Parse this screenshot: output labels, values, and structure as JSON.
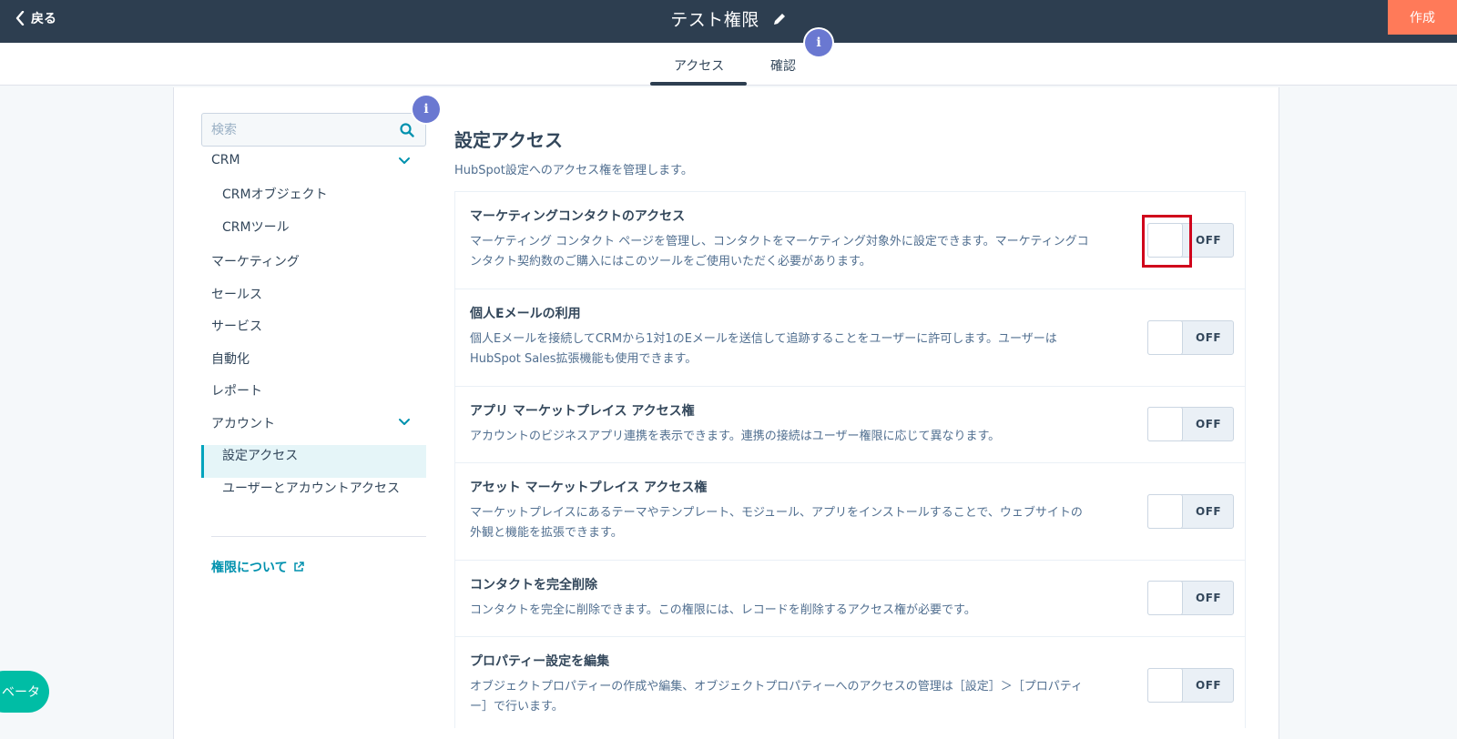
{
  "header": {
    "back_label": "戻る",
    "title": "テスト権限",
    "create_label": "作成",
    "colors": {
      "bar": "#2d3e50",
      "create": "#ff7a59"
    }
  },
  "tabs": [
    {
      "label": "アクセス",
      "active": true
    },
    {
      "label": "確認",
      "active": false
    }
  ],
  "info_badge": {
    "symbol": "i",
    "color": "#6a78d1"
  },
  "sidebar": {
    "search_placeholder": "検索",
    "items": [
      {
        "label": "CRM",
        "expandable": true
      },
      {
        "label": "CRMオブジェクト",
        "sub": true
      },
      {
        "label": "CRMツール",
        "sub": true
      },
      {
        "label": "マーケティング"
      },
      {
        "label": "セールス"
      },
      {
        "label": "サービス"
      },
      {
        "label": "自動化"
      },
      {
        "label": "レポート"
      },
      {
        "label": "アカウント",
        "expandable": true
      },
      {
        "label": "設定アクセス",
        "sub": true,
        "active": true
      },
      {
        "label": "ユーザーとアカウントアクセス",
        "sub": true
      }
    ],
    "about_link": "権限について"
  },
  "main": {
    "title": "設定アクセス",
    "description": "HubSpot設定へのアクセス権を管理します。",
    "permissions": [
      {
        "title": "マーケティングコンタクトのアクセス",
        "desc_line1": "マーケティング コンタクト ページを管理し、コンタクトをマーケティング対象外に設定できます。マーケティングコ",
        "desc_line2": "ンタクト契約数のご購入にはこのツールをご使用いただく必要があります。",
        "toggle": "OFF",
        "highlighted": true
      },
      {
        "title": "個人Eメールの利用",
        "desc_line1": "個人Eメールを接続してCRMから1対1のEメールを送信して追跡することをユーザーに許可します。ユーザーは",
        "desc_line2": "HubSpot Sales拡張機能も使用できます。",
        "toggle": "OFF"
      },
      {
        "title": "アプリ マーケットプレイス アクセス権",
        "desc_line1": "アカウントのビジネスアプリ連携を表示できます。連携の接続はユーザー権限に応じて異なります。",
        "desc_line2": "",
        "toggle": "OFF"
      },
      {
        "title": "アセット マーケットプレイス アクセス権",
        "desc_line1": "マーケットプレイスにあるテーマやテンプレート、モジュール、アプリをインストールすることで、ウェブサイトの",
        "desc_line2": "外観と機能を拡張できます。",
        "toggle": "OFF"
      },
      {
        "title": "コンタクトを完全削除",
        "desc_line1": "コンタクトを完全に削除できます。この権限には、レコードを削除するアクセス権が必要です。",
        "desc_line2": "",
        "toggle": "OFF"
      },
      {
        "title": "プロパティー設定を編集",
        "desc_line1": "オブジェクトプロパティーの作成や編集、オブジェクトプロパティーへのアクセスの管理は［設定］＞［プロパティ",
        "desc_line2": "ー］で行います。",
        "toggle": "OFF"
      }
    ]
  },
  "beta_label": "ベータ"
}
